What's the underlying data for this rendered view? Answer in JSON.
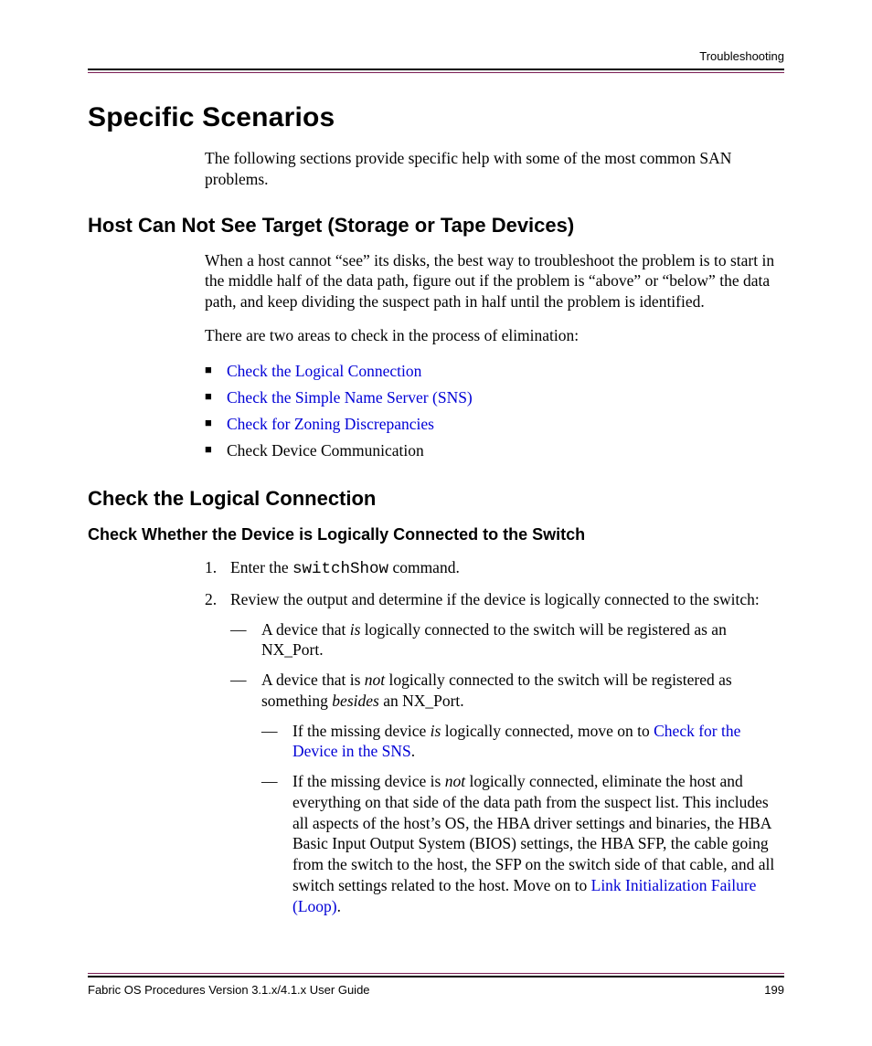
{
  "header": {
    "label": "Troubleshooting"
  },
  "section": {
    "title": "Specific Scenarios",
    "intro": "The following sections provide specific help with some of the most common SAN problems."
  },
  "host_section": {
    "title": "Host Can Not See Target (Storage or Tape Devices)",
    "p1": "When a host cannot “see” its disks, the best way to troubleshoot the problem is to start in the middle half of the data path, figure out if the problem is “above” or “below” the data path, and keep dividing the suspect path in half until the problem is identified.",
    "p2": "There are two areas to check in the process of elimination:",
    "bullets": {
      "b1": "Check the Logical Connection",
      "b2": "Check the Simple Name Server (SNS)",
      "b3": "Check for Zoning Discrepancies",
      "b4": "Check Device Communication"
    }
  },
  "check_logical": {
    "title": "Check the Logical Connection",
    "sub": "Check Whether the Device is Logically Connected to the Switch",
    "step1_pre": "Enter the ",
    "step1_cmd": "switchShow",
    "step1_post": " command.",
    "step2": "Review the output and determine if the device is logically connected to the switch:",
    "d1_pre": "A device that ",
    "d1_em": "is",
    "d1_post": " logically connected to the switch will be registered as an NX_Port.",
    "d2_pre": "A device that is ",
    "d2_em": "not",
    "d2_mid": " logically connected to the switch will be registered as something ",
    "d2_em2": "besides",
    "d2_post": " an NX_Port.",
    "n1_pre": "If the missing device ",
    "n1_em": "is",
    "n1_mid": " logically connected, move on to ",
    "n1_link": "Check for the Device in the SNS",
    "n1_post": ".",
    "n2_pre": "If the missing device is ",
    "n2_em": "not",
    "n2_mid": " logically connected, eliminate the host and everything on that side of the data path from the suspect list. This includes all aspects of the host’s OS, the HBA driver settings and binaries, the HBA Basic Input Output System (BIOS) settings, the HBA SFP, the cable going from the switch to the host, the SFP on the switch side of that cable, and all switch settings related to the host. Move on to ",
    "n2_link": "Link Initialization Failure (Loop)",
    "n2_post": "."
  },
  "footer": {
    "left": "Fabric OS Procedures Version 3.1.x/4.1.x User Guide",
    "right": "199"
  }
}
